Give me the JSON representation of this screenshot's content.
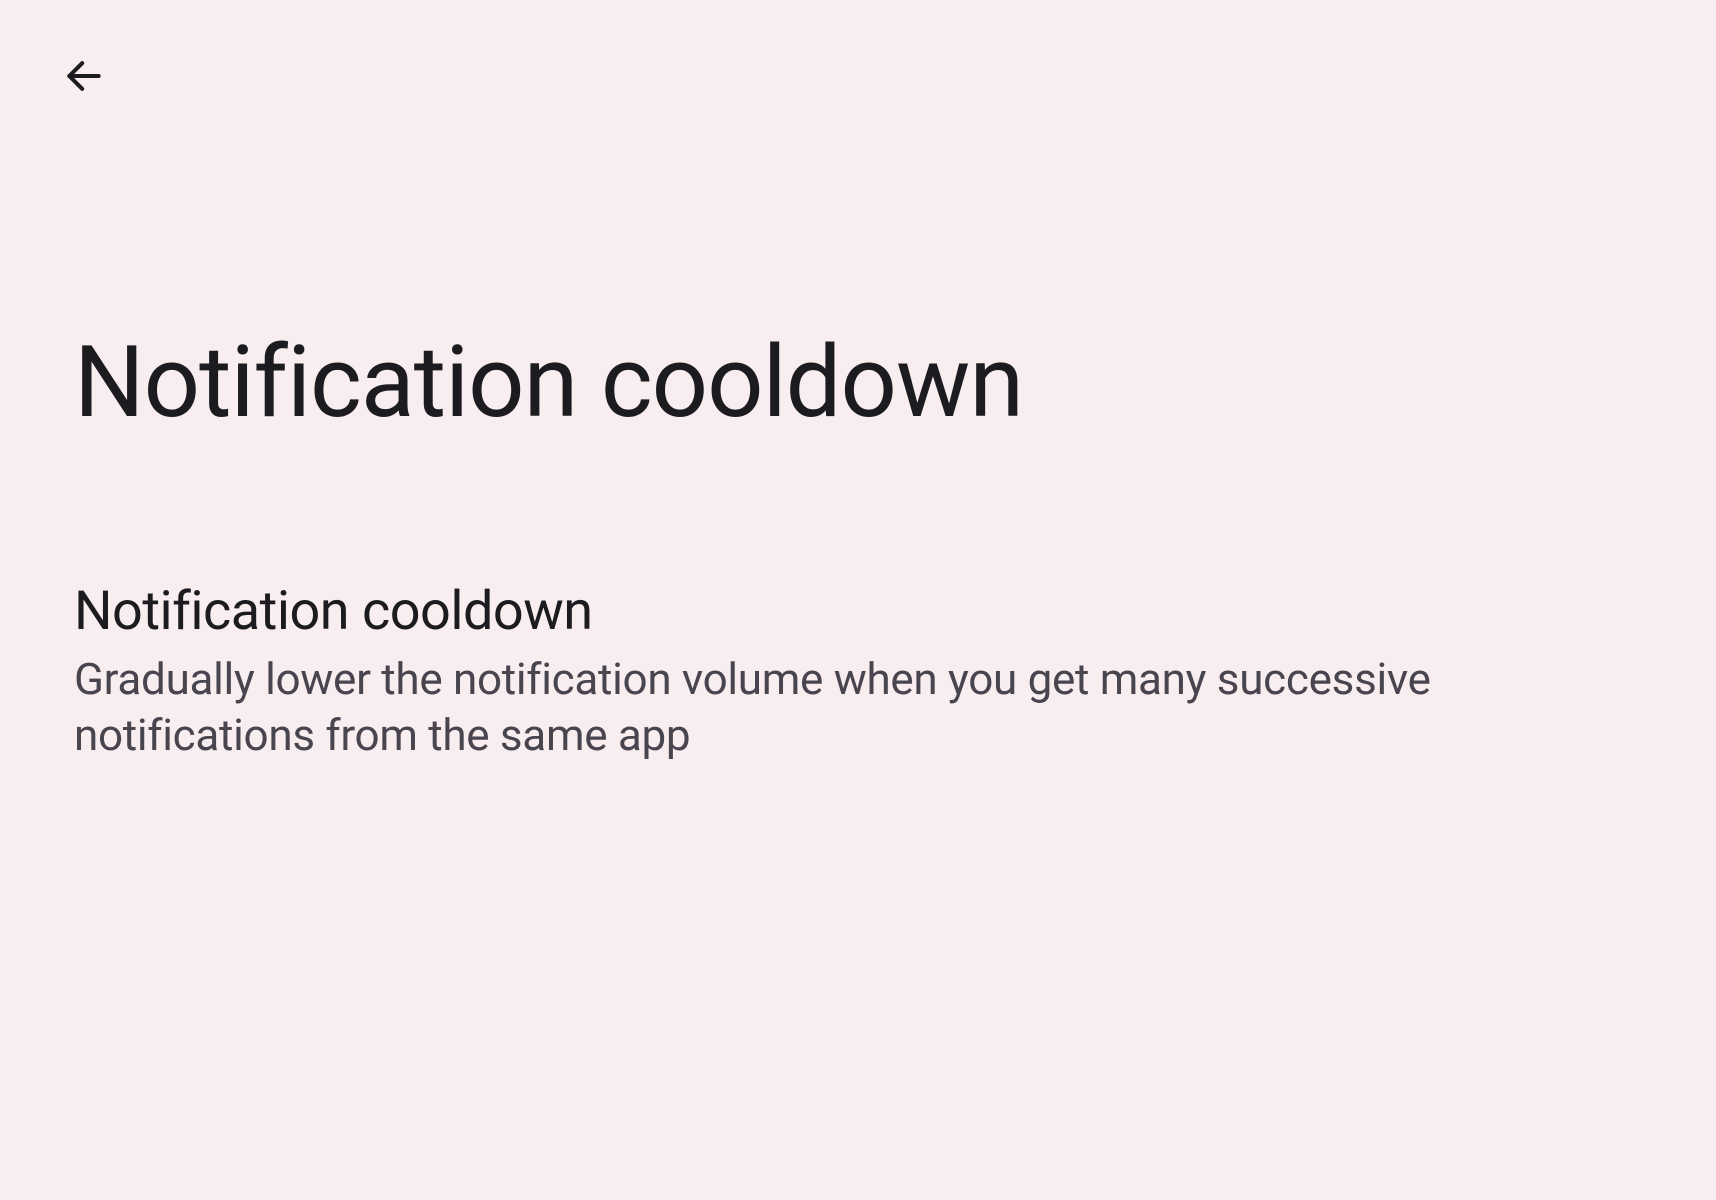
{
  "header": {
    "page_title": "Notification cooldown"
  },
  "setting": {
    "title": "Notification cooldown",
    "description": "Gradually lower the notification volume when you get many successive notifications from the same app"
  }
}
